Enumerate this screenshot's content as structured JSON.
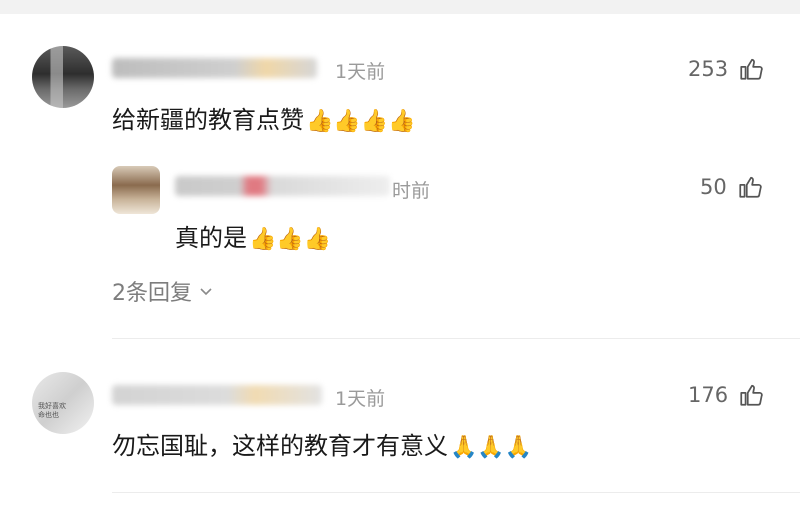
{
  "comments": [
    {
      "meta": "1天前",
      "likes": "253",
      "text": "给新疆的教育点赞",
      "emoji": "👍👍👍👍"
    },
    {
      "meta": "时前",
      "likes": "50",
      "text": "真的是",
      "emoji": "👍👍👍"
    },
    {
      "meta": "1天前",
      "likes": "176",
      "text": "勿忘国耻，这样的教育才有意义",
      "emoji": "🙏🙏🙏"
    }
  ],
  "replies_label": "2条回复",
  "avatar3_text": "我好喜欢\n命也也"
}
